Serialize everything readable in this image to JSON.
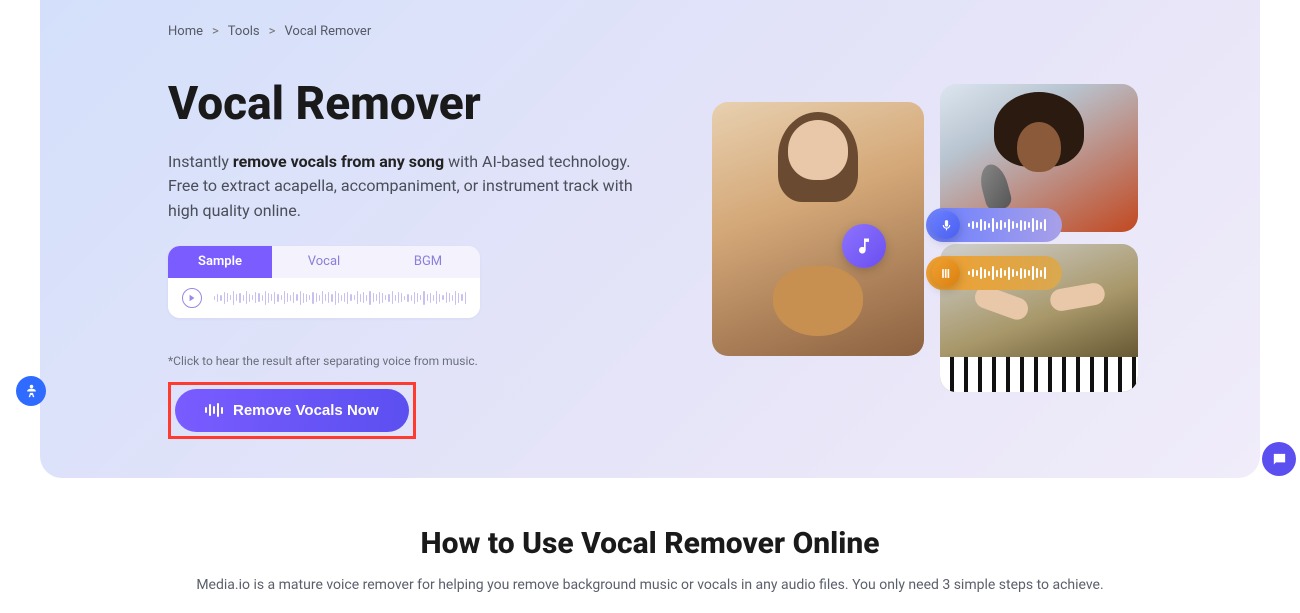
{
  "breadcrumb": {
    "home": "Home",
    "sep": ">",
    "tools": "Tools",
    "current": "Vocal Remover"
  },
  "hero": {
    "title": "Vocal Remover",
    "description_prefix": "Instantly ",
    "description_bold": "remove vocals from any song",
    "description_suffix": " with AI-based technology. Free to extract acapella, accompaniment, or instrument track with high quality online.",
    "tabs": {
      "sample": "Sample",
      "vocal": "Vocal",
      "bgm": "BGM"
    },
    "hint": "*Click to hear the result after separating voice from music.",
    "cta_label": "Remove Vocals Now"
  },
  "howto": {
    "title": "How to Use Vocal Remover Online",
    "subtitle": "Media.io is a mature voice remover for helping you remove background music or vocals in any audio files. You only need 3 simple steps to achieve."
  },
  "colors": {
    "accent": "#7a5cff",
    "highlight_border": "#ff3b30"
  }
}
